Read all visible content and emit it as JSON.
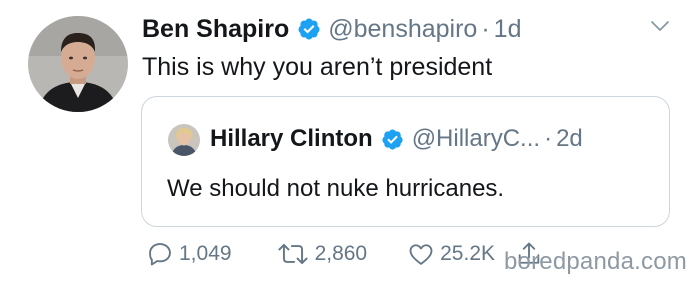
{
  "tweet": {
    "display_name": "Ben Shapiro",
    "handle": "@benshapiro",
    "separator": "·",
    "time": "1d",
    "text": "This is why you aren’t president",
    "avatar_icon": "user-avatar",
    "verified_icon": "verified-badge-icon",
    "more_icon": "chevron-down-icon"
  },
  "quoted_tweet": {
    "display_name": "Hillary Clinton",
    "handle": "@HillaryC...",
    "separator": "·",
    "time": "2d",
    "text": "We should not nuke hurricanes."
  },
  "actions": {
    "replies": "1,049",
    "retweets": "2,860",
    "likes": "25.2K"
  },
  "watermark": "boredpanda.com",
  "colors": {
    "verified": "#1da1f2",
    "text": "#14171a",
    "muted": "#657786",
    "border": "#ccd6dd"
  }
}
